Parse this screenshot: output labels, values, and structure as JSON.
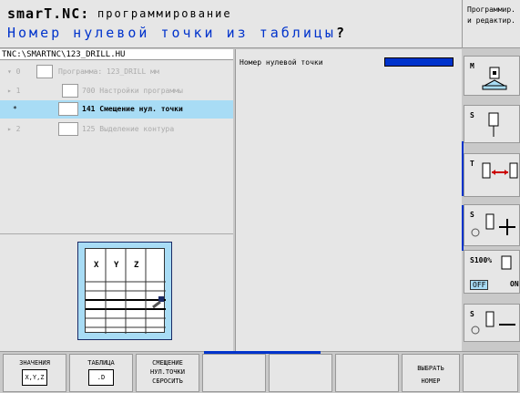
{
  "header": {
    "app_name": "smarT.NC:",
    "mode": "программирование",
    "prompt": "Номер нулевой точки из таблицы",
    "prompt_mark": "?",
    "mode_box_line1": "Программир.",
    "mode_box_line2": "и редактир."
  },
  "path": "TNC:\\SMARTNC\\123_DRILL.HU",
  "tree": {
    "rows": [
      {
        "mark": "▾ 0",
        "text": "Программа: 123_DRILL мм"
      },
      {
        "mark": "▸ 1",
        "text": "700 Настройки программы"
      },
      {
        "mark": "*",
        "text": "141 Смещение нул. точки"
      },
      {
        "mark": "▸ 2",
        "text": "125 Выделение контура"
      }
    ]
  },
  "graphic": {
    "columns": [
      "X",
      "Y",
      "Z"
    ]
  },
  "form": {
    "field_label": "Номер нулевой точки"
  },
  "sidebar": {
    "m_label": "M",
    "s_label": "S",
    "t_label": "T",
    "s2_label": "S",
    "s100_label": "S100%",
    "off_label": "OFF",
    "on_label": "ON",
    "s3_label": "S"
  },
  "softkeys": {
    "k1": "ЗНАЧЕНИЯ",
    "k1_icon": "X,Y,Z",
    "k2": "ТАБЛИЦА",
    "k2_icon": ".D",
    "k3_l1": "СМЕЩЕНИЕ",
    "k3_l2": "НУЛ.ТОЧКИ",
    "k3_l3": "СБРОСИТЬ",
    "k7_l1": "ВЫБРАТЬ",
    "k7_l2": "НОМЕР"
  },
  "colors": {
    "accent": "#0033cc",
    "selection": "#a8dcf5",
    "panel": "#e6e6e6"
  }
}
